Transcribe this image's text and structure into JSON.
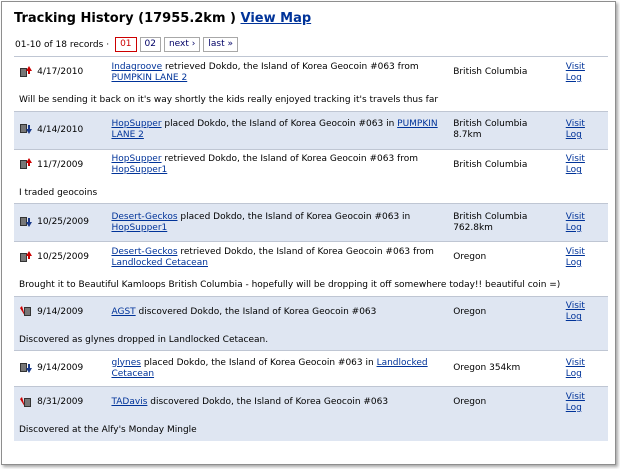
{
  "header": {
    "title": "Tracking History (17955.2km )",
    "view_map": "View Map"
  },
  "pager": {
    "count": "01-10 of 18 records",
    "separator": "·",
    "page1": "01",
    "page2": "02",
    "next": "next ›",
    "last": "last »"
  },
  "entries": [
    {
      "icon": "retrieved-icon",
      "date": "4/17/2010",
      "user": "Indagroove",
      "action": " retrieved Dokdo, the Island of Korea Geocoin #063 from ",
      "cache": "PUMPKIN LANE 2",
      "location": "British Columbia",
      "distance": "",
      "visit": "Visit",
      "log": "Log",
      "note": "Will be sending it back on it's way shortly the kids really enjoyed tracking it's travels thus far"
    },
    {
      "icon": "placed-icon",
      "date": "4/14/2010",
      "user": "HopSupper",
      "action": " placed Dokdo, the Island of Korea Geocoin #063 in ",
      "cache": "PUMPKIN LANE 2",
      "location": "British Columbia",
      "distance": "8.7km",
      "visit": "Visit",
      "log": "Log",
      "note": ""
    },
    {
      "icon": "retrieved-icon",
      "date": "11/7/2009",
      "user": "HopSupper",
      "action": " retrieved Dokdo, the Island of Korea Geocoin #063 from ",
      "cache": "HopSupper1",
      "location": "British Columbia",
      "distance": "",
      "visit": "Visit",
      "log": "Log",
      "note": "I traded geocoins"
    },
    {
      "icon": "placed-icon",
      "date": "10/25/2009",
      "user": "Desert-Geckos",
      "action": " placed Dokdo, the Island of Korea Geocoin #063 in ",
      "cache": "HopSupper1",
      "location": "British Columbia",
      "distance": "762.8km",
      "visit": "Visit",
      "log": "Log",
      "note": ""
    },
    {
      "icon": "retrieved-icon",
      "date": "10/25/2009",
      "user": "Desert-Geckos",
      "action": " retrieved Dokdo, the Island of Korea Geocoin #063 from ",
      "cache": "Landlocked Cetacean",
      "location": "Oregon",
      "distance": "",
      "visit": "Visit",
      "log": "Log",
      "note": "Brought it to Beautiful Kamloops British Columbia - hopefully will be dropping it off somewhere today!! beautiful coin =)"
    },
    {
      "icon": "discovered-icon",
      "date": "9/14/2009",
      "user": "AGST",
      "action": " discovered Dokdo, the Island of Korea Geocoin #063",
      "cache": "",
      "location": "Oregon",
      "distance": "",
      "visit": "Visit",
      "log": "Log",
      "note": "Discovered as glynes dropped in Landlocked Cetacean."
    },
    {
      "icon": "placed-icon",
      "date": "9/14/2009",
      "user": "glynes",
      "action": " placed Dokdo, the Island of Korea Geocoin #063 in ",
      "cache": "Landlocked Cetacean",
      "location": "Oregon 354km",
      "distance": "",
      "visit": "Visit",
      "log": "Log",
      "note": ""
    },
    {
      "icon": "discovered-icon",
      "date": "8/31/2009",
      "user": "TADavis",
      "action": " discovered Dokdo, the Island of Korea Geocoin #063",
      "cache": "",
      "location": "Oregon",
      "distance": "",
      "visit": "Visit",
      "log": "Log",
      "note": "Discovered at the Alfy's Monday Mingle"
    }
  ],
  "colors": {
    "link": "#003399",
    "row_alt": "#dfe6f2",
    "current_page": "#cc0000"
  }
}
